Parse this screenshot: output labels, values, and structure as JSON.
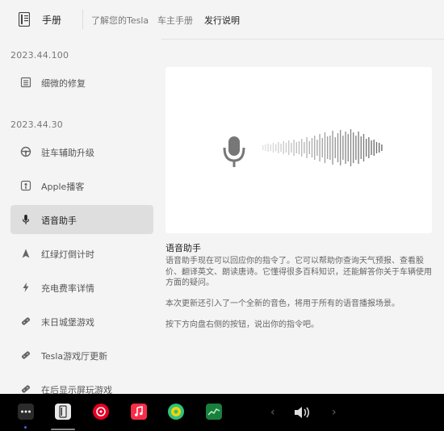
{
  "header": {
    "title": "手册",
    "tabs": [
      {
        "label": "了解您的Tesla"
      },
      {
        "label": "车主手册"
      },
      {
        "label": "发行说明",
        "active": true
      }
    ]
  },
  "sidebar": {
    "sections": [
      {
        "version": "2023.44.100",
        "items": [
          {
            "label": "细微的修复",
            "icon": "list-icon"
          }
        ]
      },
      {
        "version": "2023.44.30",
        "items": [
          {
            "label": "驻车辅助升级",
            "icon": "steering-wheel-icon"
          },
          {
            "label": "Apple播客",
            "icon": "podcast-icon"
          },
          {
            "label": "语音助手",
            "icon": "microphone-icon",
            "selected": true
          },
          {
            "label": "红绿灯倒计时",
            "icon": "navigation-arrow-icon"
          },
          {
            "label": "充电费率详情",
            "icon": "lightning-icon"
          },
          {
            "label": "末日城堡游戏",
            "icon": "game-controller-icon"
          },
          {
            "label": "Tesla游戏厅更新",
            "icon": "game-controller-icon"
          },
          {
            "label": "在后显示屏玩游戏",
            "icon": "game-controller-icon"
          }
        ]
      }
    ]
  },
  "content": {
    "title": "语音助手",
    "paragraphs": [
      "语音助手现在可以回应你的指令了。它可以帮助你查询天气预报、查看股价、翻译英文、朗读唐诗。它懂得很多百科知识，还能解答你关于车辆使用方面的疑问。",
      "本次更新还引入了一个全新的音色，将用于所有的语音播报场景。",
      "按下方向盘右侧的按钮，说出你的指令吧。"
    ]
  },
  "taskbar": {
    "apps": [
      "more-apps-icon",
      "manual-icon",
      "netease-music-icon",
      "apple-music-icon",
      "qq-music-icon",
      "stocks-icon"
    ],
    "colors": {
      "netease": "#e60026",
      "apple_music": "#fa2d48",
      "qq_music": "#31c27c",
      "stocks": "#1a7f3c"
    },
    "controls": [
      "previous-arrow-icon",
      "volume-icon",
      "next-arrow-icon"
    ]
  }
}
